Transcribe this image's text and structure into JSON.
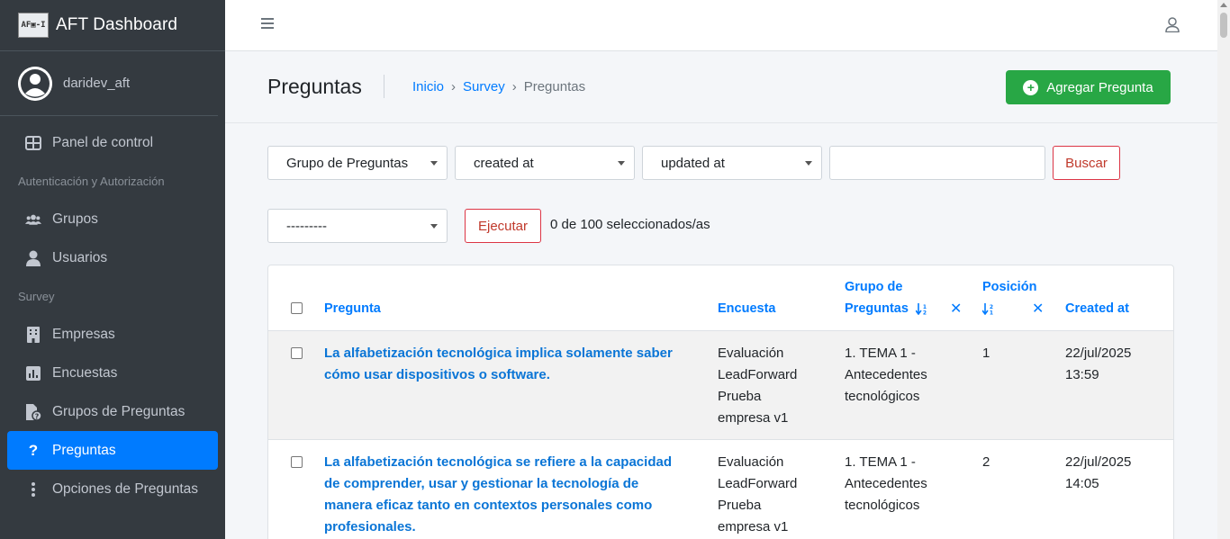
{
  "brand": {
    "logo_text": "AF▣-I",
    "name": "AFT Dashboard"
  },
  "user": {
    "name": "daridev_aft"
  },
  "sidebar": {
    "items": [
      {
        "label": "Panel de control",
        "icon": "dashboard-icon"
      }
    ],
    "section_auth": "Autenticación y Autorización",
    "auth_items": [
      {
        "label": "Grupos",
        "icon": "users-icon"
      },
      {
        "label": "Usuarios",
        "icon": "user-icon"
      }
    ],
    "section_survey": "Survey",
    "survey_items": [
      {
        "label": "Empresas",
        "icon": "building-icon"
      },
      {
        "label": "Encuestas",
        "icon": "chart-icon"
      },
      {
        "label": "Grupos de Preguntas",
        "icon": "file-question-icon"
      },
      {
        "label": "Preguntas",
        "icon": "question-icon",
        "active": true
      },
      {
        "label": "Opciones de Preguntas",
        "icon": "vertical-dots-icon"
      }
    ]
  },
  "page": {
    "title": "Preguntas",
    "breadcrumb": [
      "Inicio",
      "Survey",
      "Preguntas"
    ],
    "add_button": "Agregar Pregunta"
  },
  "filters": {
    "group": "Grupo de Preguntas",
    "created": "created at",
    "updated": "updated at",
    "search_button": "Buscar"
  },
  "actions": {
    "action_select": "---------",
    "run_button": "Ejecutar",
    "selection_count": "0 de 100 seleccionados/as"
  },
  "table": {
    "headers": {
      "pregunta": "Pregunta",
      "encuesta": "Encuesta",
      "grupo_line1": "Grupo de",
      "grupo_line2": "Preguntas",
      "posicion": "Posición",
      "created": "Created at",
      "remove_sort": "✕"
    },
    "rows": [
      {
        "pregunta": [
          "La alfabetización tecnológica implica solamente saber",
          "cómo usar dispositivos o software."
        ],
        "encuesta": [
          "Evaluación",
          "LeadForward",
          "Prueba",
          "empresa v1"
        ],
        "grupo": [
          "1. TEMA 1 -",
          "Antecedentes",
          "tecnológicos"
        ],
        "posicion": "1",
        "created": [
          "22/jul/2025",
          "13:59"
        ]
      },
      {
        "pregunta": [
          "La alfabetización tecnológica se refiere a la capacidad",
          "de comprender, usar y gestionar la tecnología de",
          "manera eficaz tanto en contextos personales como",
          "profesionales."
        ],
        "encuesta": [
          "Evaluación",
          "LeadForward",
          "Prueba",
          "empresa v1"
        ],
        "grupo": [
          "1. TEMA 1 -",
          "Antecedentes",
          "tecnológicos"
        ],
        "posicion": "2",
        "created": [
          "22/jul/2025",
          "14:05"
        ]
      }
    ]
  }
}
